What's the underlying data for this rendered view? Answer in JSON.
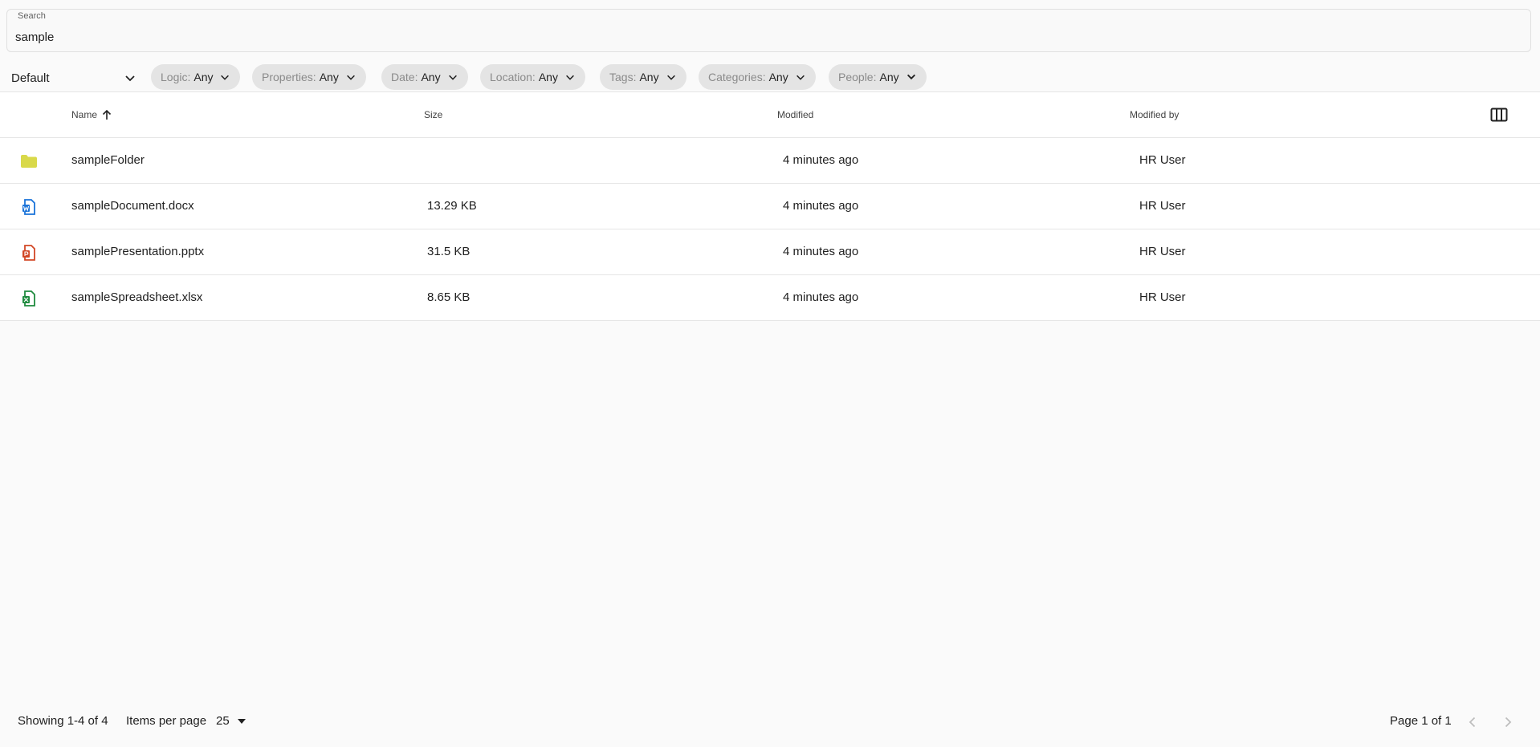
{
  "search": {
    "label": "Search",
    "value": "sample"
  },
  "filters": {
    "sort": {
      "value": "Default"
    },
    "chips": [
      {
        "label": "Logic:",
        "value": "Any"
      },
      {
        "label": "Properties:",
        "value": "Any"
      },
      {
        "label": "Date:",
        "value": "Any"
      },
      {
        "label": "Location:",
        "value": "Any"
      },
      {
        "label": "Tags:",
        "value": "Any"
      },
      {
        "label": "Categories:",
        "value": "Any"
      },
      {
        "label": "People:",
        "value": "Any"
      }
    ]
  },
  "table": {
    "columns": {
      "name": "Name",
      "size": "Size",
      "modified": "Modified",
      "modified_by": "Modified by"
    },
    "sort": {
      "column": "name",
      "direction": "ascending"
    },
    "rows": [
      {
        "icon": "folder-icon",
        "color": "#d9d94a",
        "name": "sampleFolder",
        "size": "",
        "modified": "4 minutes ago",
        "modified_by": "HR User"
      },
      {
        "icon": "word-document-icon",
        "color": "#1a73d9",
        "name": "sampleDocument.docx",
        "size": "13.29 KB",
        "modified": "4 minutes ago",
        "modified_by": "HR User"
      },
      {
        "icon": "powerpoint-document-icon",
        "color": "#d24726",
        "name": "samplePresentation.pptx",
        "size": "31.5 KB",
        "modified": "4 minutes ago",
        "modified_by": "HR User"
      },
      {
        "icon": "excel-document-icon",
        "color": "#1e8a3e",
        "name": "sampleSpreadsheet.xlsx",
        "size": "8.65 KB",
        "modified": "4 minutes ago",
        "modified_by": "HR User"
      }
    ]
  },
  "pagination": {
    "showing": "Showing 1-4 of 4",
    "items_per_page_label": "Items per page",
    "items_per_page_value": "25",
    "page_info": "Page 1 of 1"
  }
}
